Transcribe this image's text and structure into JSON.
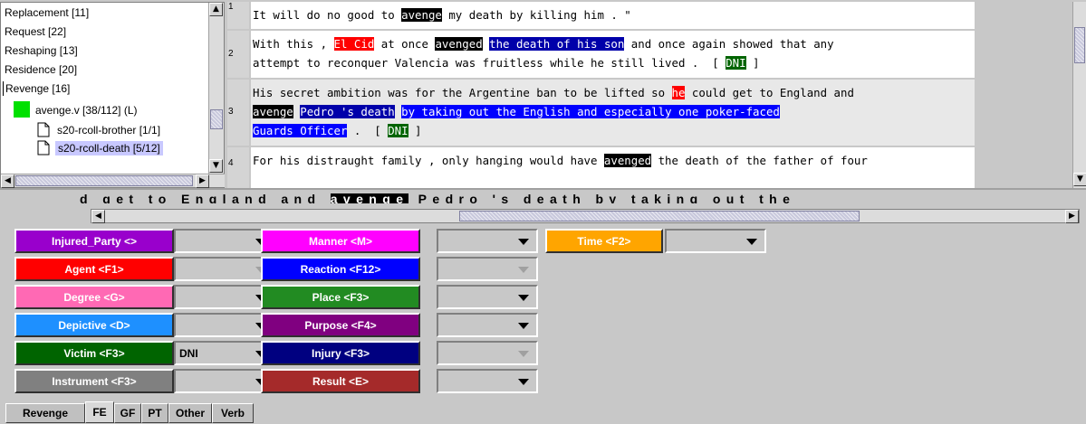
{
  "tree": {
    "items": [
      {
        "label": "Replacement [11]"
      },
      {
        "label": "Request [22]"
      },
      {
        "label": "Reshaping [13]"
      },
      {
        "label": "Residence [20]"
      },
      {
        "label": "Revenge [16]"
      },
      {
        "label": "avenge.v [38/112] (L)",
        "color": "#00e000"
      },
      {
        "label": "s20-rcoll-brother [1/1]"
      },
      {
        "label": "s20-rcoll-death [5/12]"
      }
    ]
  },
  "sentences": [
    {
      "num": "1",
      "segments": [
        {
          "t": "It will do no good to ",
          "c": ""
        },
        {
          "t": "avenge",
          "c": "hl-black"
        },
        {
          "t": " my death by killing him . \"",
          "c": ""
        }
      ]
    },
    {
      "num": "2",
      "line1": [
        {
          "t": "With this , ",
          "c": ""
        },
        {
          "t": "El Cid",
          "c": "hl-red"
        },
        {
          "t": " at once ",
          "c": ""
        },
        {
          "t": "avenged",
          "c": "hl-black"
        },
        {
          "t": " ",
          "c": ""
        },
        {
          "t": "the death of his son",
          "c": "hl-navy"
        },
        {
          "t": " and once again showed that any",
          "c": ""
        }
      ],
      "line2": [
        {
          "t": "attempt to reconquer Valencia was fruitless while he still lived .  [ ",
          "c": ""
        },
        {
          "t": "DNI",
          "c": "hl-green"
        },
        {
          "t": " ]",
          "c": ""
        }
      ]
    },
    {
      "num": "3",
      "line1": [
        {
          "t": "His secret ambition was for the Argentine ban to be lifted so ",
          "c": ""
        },
        {
          "t": "he",
          "c": "hl-red"
        },
        {
          "t": " could get to England and",
          "c": ""
        }
      ],
      "line2": [
        {
          "t": "avenge",
          "c": "hl-black"
        },
        {
          "t": " ",
          "c": ""
        },
        {
          "t": "Pedro 's death",
          "c": "hl-navy"
        },
        {
          "t": " ",
          "c": ""
        },
        {
          "t": "by taking out the English and especially one poker-faced",
          "c": "hl-blue"
        }
      ],
      "line3": [
        {
          "t": "Guards Officer",
          "c": "hl-blue"
        },
        {
          "t": " .  [ ",
          "c": ""
        },
        {
          "t": "DNI",
          "c": "hl-green"
        },
        {
          "t": " ]",
          "c": ""
        }
      ]
    },
    {
      "num": "4",
      "segments": [
        {
          "t": "For his distraught family , only hanging would have ",
          "c": ""
        },
        {
          "t": "avenged",
          "c": "hl-black"
        },
        {
          "t": " the death of the father of four",
          "c": ""
        }
      ]
    }
  ],
  "ticker": {
    "before": "d get to England and ",
    "highlight": "avenge",
    "after": " Pedro 's death by taking out the"
  },
  "fe": [
    {
      "label": "Injured_Party <>",
      "color": "#9900cc",
      "value": "",
      "disabled": false
    },
    {
      "label": "Agent <F1>",
      "color": "#ff0000",
      "value": "",
      "disabled": true
    },
    {
      "label": "Degree <G>",
      "color": "#ff69b4",
      "value": "",
      "disabled": false
    },
    {
      "label": "Depictive <D>",
      "color": "#1e90ff",
      "value": "",
      "disabled": false
    },
    {
      "label": "Victim <F3>",
      "color": "#006400",
      "value": "DNI",
      "disabled": false
    },
    {
      "label": "Instrument <F3>",
      "color": "#808080",
      "value": "",
      "disabled": false
    },
    {
      "label": "Manner <M>",
      "color": "#ff00ff",
      "value": "",
      "disabled": false
    },
    {
      "label": "Reaction <F12>",
      "color": "#0000ff",
      "value": "",
      "disabled": true
    },
    {
      "label": "Place <F3>",
      "color": "#228b22",
      "value": "",
      "disabled": false
    },
    {
      "label": "Purpose <F4>",
      "color": "#800080",
      "value": "",
      "disabled": false
    },
    {
      "label": "Injury <F3>",
      "color": "#000080",
      "value": "",
      "disabled": true
    },
    {
      "label": "Result <E>",
      "color": "#a52a2a",
      "value": "",
      "disabled": false
    },
    {
      "label": "Time <F2>",
      "color": "#ffa500",
      "value": "",
      "disabled": false
    }
  ],
  "tabs": [
    {
      "label": "Revenge",
      "active": false
    },
    {
      "label": "FE",
      "active": true
    },
    {
      "label": "GF",
      "active": false
    },
    {
      "label": "PT",
      "active": false
    },
    {
      "label": "Other",
      "active": false
    },
    {
      "label": "Verb",
      "active": false
    }
  ]
}
